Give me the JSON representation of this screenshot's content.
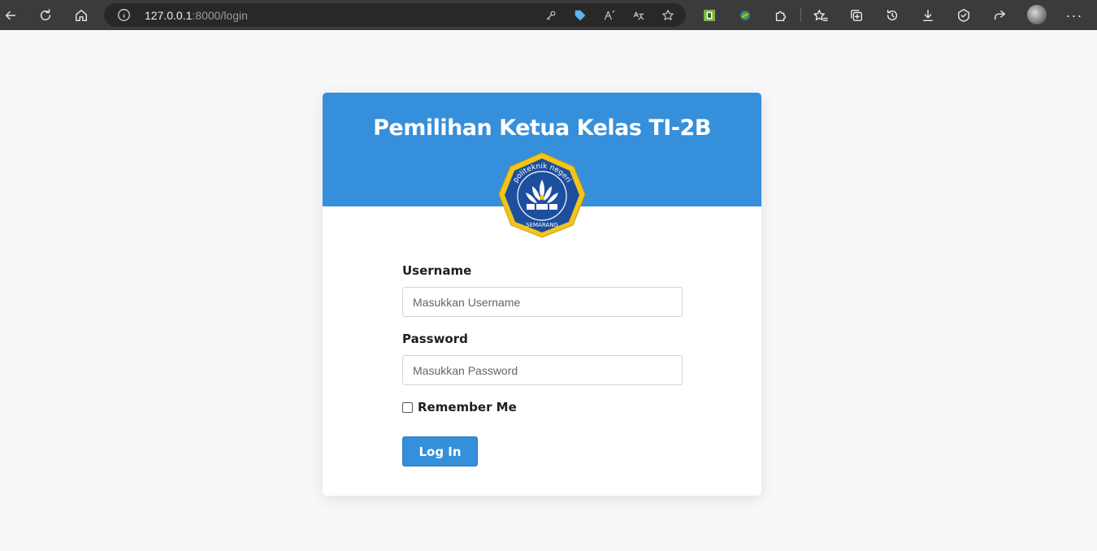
{
  "browser": {
    "url_host": "127.0.0.1",
    "url_rest": ":8000/login"
  },
  "page": {
    "title": "Pemilihan Ketua Kelas TI-2B",
    "logo_text_top": "politeknik negeri",
    "logo_text_bottom": "SEMARANG"
  },
  "form": {
    "username_label": "Username",
    "username_placeholder": "Masukkan Username",
    "password_label": "Password",
    "password_placeholder": "Masukkan Password",
    "remember_label": "Remember Me",
    "login_label": "Log In"
  },
  "colors": {
    "accent": "#358fdb",
    "page_bg": "#f7f8fa",
    "toolbar_bg": "#3b3b3b"
  }
}
